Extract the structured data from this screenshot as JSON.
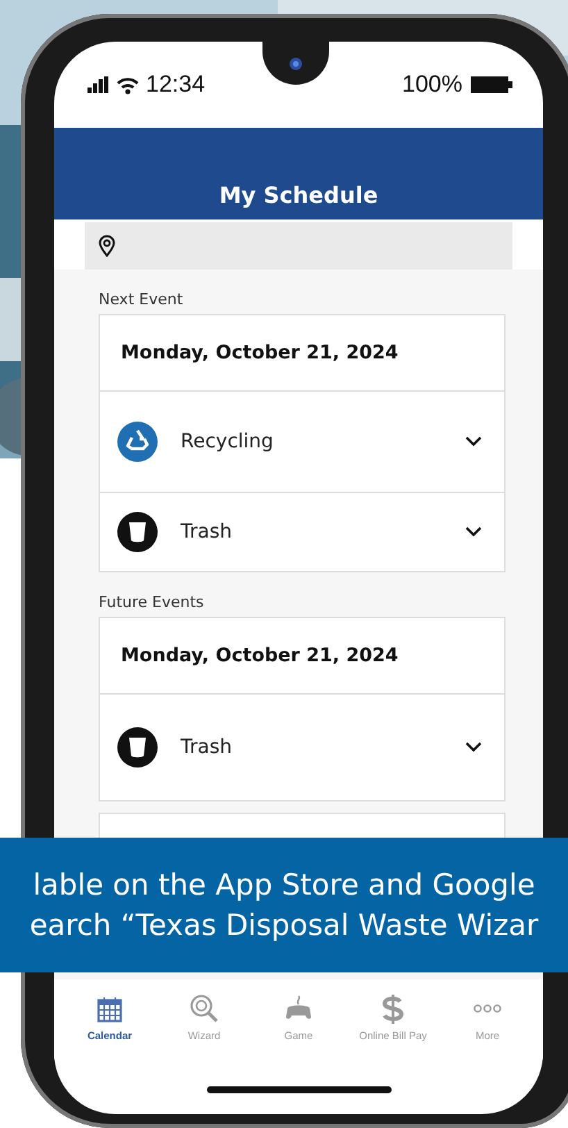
{
  "status_bar": {
    "time": "12:34",
    "battery": "100%"
  },
  "header": {
    "title": "My Schedule"
  },
  "sections": [
    {
      "label": "Next Event",
      "events": [
        {
          "date": "Monday, October 21, 2024",
          "items": [
            {
              "name": "Recycling",
              "kind": "recycling",
              "expanded": false
            },
            {
              "name": "Trash",
              "kind": "trash",
              "expanded": false
            }
          ]
        }
      ]
    },
    {
      "label": "Future Events",
      "events": [
        {
          "date": "Monday, October 21, 2024",
          "items": [
            {
              "name": "Trash",
              "kind": "trash",
              "expanded": false
            }
          ]
        }
      ]
    }
  ],
  "bottom_nav": [
    {
      "label": "Calendar",
      "kind": "calendar",
      "selected": true
    },
    {
      "label": "Wizard",
      "kind": "wizard",
      "selected": false
    },
    {
      "label": "Game",
      "kind": "game",
      "selected": false
    },
    {
      "label": "Online Bill Pay",
      "kind": "pay",
      "selected": false
    },
    {
      "label": "More",
      "kind": "more",
      "selected": false
    }
  ],
  "banner": {
    "lines": [
      "lable on the App Store and Google",
      "earch “Texas Disposal Waste Wizar"
    ]
  }
}
